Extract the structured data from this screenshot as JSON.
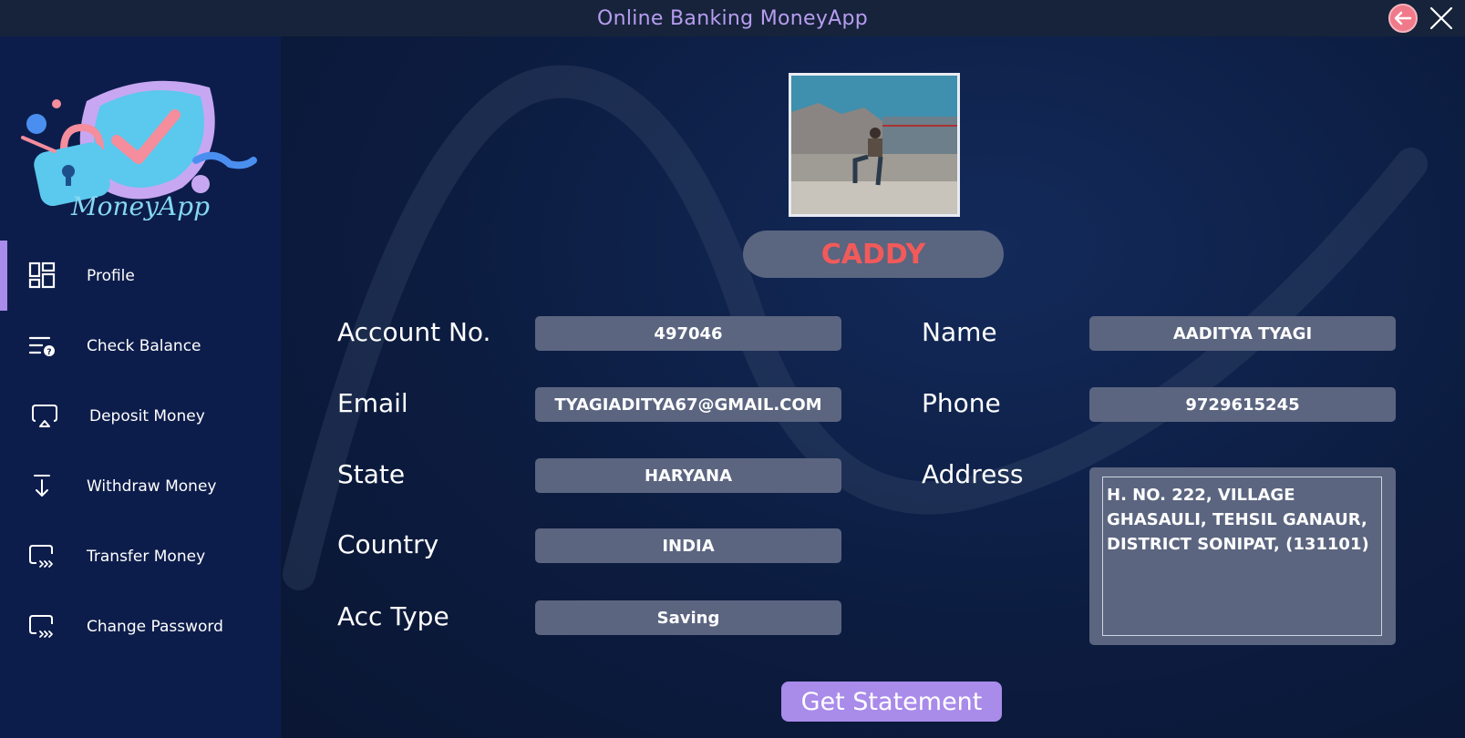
{
  "window": {
    "title": "Online Banking MoneyApp",
    "back_icon": "back-arrow-circle-icon",
    "close_icon": "close-icon",
    "title_color": "#b79df0"
  },
  "sidebar": {
    "brand": "MoneyApp",
    "accent_color": "#a98bea",
    "items": [
      {
        "label": "Profile",
        "icon": "dashboard-grid-icon",
        "active": true
      },
      {
        "label": "Check Balance",
        "icon": "balance-check-icon",
        "active": false
      },
      {
        "label": "Deposit Money",
        "icon": "deposit-icon",
        "active": false
      },
      {
        "label": "Withdraw Money",
        "icon": "withdraw-icon",
        "active": false
      },
      {
        "label": "Transfer Money",
        "icon": "transfer-icon",
        "active": false
      },
      {
        "label": "Change Password",
        "icon": "change-password-icon",
        "active": false
      }
    ]
  },
  "profile": {
    "username": "CADDY",
    "username_color": "#f25a5a",
    "fields": {
      "account_no": {
        "label": "Account No.",
        "value": "497046"
      },
      "email": {
        "label": "Email",
        "value": "TYAGIADITYA67@GMAIL.COM"
      },
      "state": {
        "label": "State",
        "value": "HARYANA"
      },
      "country": {
        "label": "Country",
        "value": "INDIA"
      },
      "acc_type": {
        "label": "Acc Type",
        "value": "Saving"
      },
      "name": {
        "label": "Name",
        "value": "AADITYA TYAGI"
      },
      "phone": {
        "label": "Phone",
        "value": "9729615245"
      },
      "address": {
        "label": "Address",
        "value": "H. NO. 222, VILLAGE\nGHASAULI, TEHSIL GANAUR,\nDISTRICT SONIPAT, (131101)"
      }
    },
    "get_statement_label": "Get Statement"
  }
}
